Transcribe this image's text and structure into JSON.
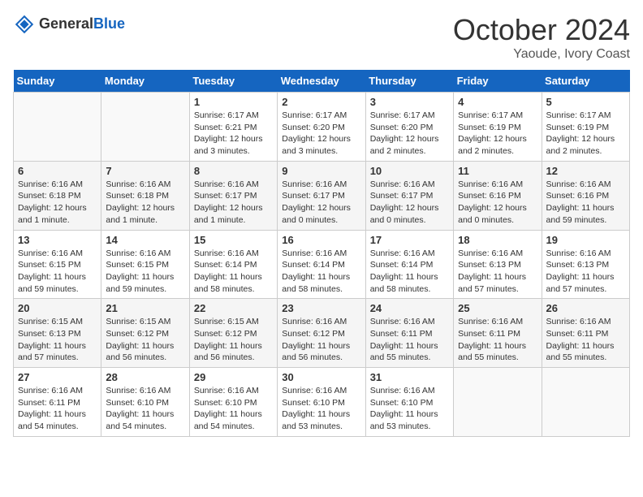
{
  "header": {
    "logo": {
      "general": "General",
      "blue": "Blue"
    },
    "month": "October 2024",
    "location": "Yaoude, Ivory Coast"
  },
  "weekdays": [
    "Sunday",
    "Monday",
    "Tuesday",
    "Wednesday",
    "Thursday",
    "Friday",
    "Saturday"
  ],
  "weeks": [
    [
      {
        "day": "",
        "info": ""
      },
      {
        "day": "",
        "info": ""
      },
      {
        "day": "1",
        "info": "Sunrise: 6:17 AM\nSunset: 6:21 PM\nDaylight: 12 hours and 3 minutes."
      },
      {
        "day": "2",
        "info": "Sunrise: 6:17 AM\nSunset: 6:20 PM\nDaylight: 12 hours and 3 minutes."
      },
      {
        "day": "3",
        "info": "Sunrise: 6:17 AM\nSunset: 6:20 PM\nDaylight: 12 hours and 2 minutes."
      },
      {
        "day": "4",
        "info": "Sunrise: 6:17 AM\nSunset: 6:19 PM\nDaylight: 12 hours and 2 minutes."
      },
      {
        "day": "5",
        "info": "Sunrise: 6:17 AM\nSunset: 6:19 PM\nDaylight: 12 hours and 2 minutes."
      }
    ],
    [
      {
        "day": "6",
        "info": "Sunrise: 6:16 AM\nSunset: 6:18 PM\nDaylight: 12 hours and 1 minute."
      },
      {
        "day": "7",
        "info": "Sunrise: 6:16 AM\nSunset: 6:18 PM\nDaylight: 12 hours and 1 minute."
      },
      {
        "day": "8",
        "info": "Sunrise: 6:16 AM\nSunset: 6:17 PM\nDaylight: 12 hours and 1 minute."
      },
      {
        "day": "9",
        "info": "Sunrise: 6:16 AM\nSunset: 6:17 PM\nDaylight: 12 hours and 0 minutes."
      },
      {
        "day": "10",
        "info": "Sunrise: 6:16 AM\nSunset: 6:17 PM\nDaylight: 12 hours and 0 minutes."
      },
      {
        "day": "11",
        "info": "Sunrise: 6:16 AM\nSunset: 6:16 PM\nDaylight: 12 hours and 0 minutes."
      },
      {
        "day": "12",
        "info": "Sunrise: 6:16 AM\nSunset: 6:16 PM\nDaylight: 11 hours and 59 minutes."
      }
    ],
    [
      {
        "day": "13",
        "info": "Sunrise: 6:16 AM\nSunset: 6:15 PM\nDaylight: 11 hours and 59 minutes."
      },
      {
        "day": "14",
        "info": "Sunrise: 6:16 AM\nSunset: 6:15 PM\nDaylight: 11 hours and 59 minutes."
      },
      {
        "day": "15",
        "info": "Sunrise: 6:16 AM\nSunset: 6:14 PM\nDaylight: 11 hours and 58 minutes."
      },
      {
        "day": "16",
        "info": "Sunrise: 6:16 AM\nSunset: 6:14 PM\nDaylight: 11 hours and 58 minutes."
      },
      {
        "day": "17",
        "info": "Sunrise: 6:16 AM\nSunset: 6:14 PM\nDaylight: 11 hours and 58 minutes."
      },
      {
        "day": "18",
        "info": "Sunrise: 6:16 AM\nSunset: 6:13 PM\nDaylight: 11 hours and 57 minutes."
      },
      {
        "day": "19",
        "info": "Sunrise: 6:16 AM\nSunset: 6:13 PM\nDaylight: 11 hours and 57 minutes."
      }
    ],
    [
      {
        "day": "20",
        "info": "Sunrise: 6:15 AM\nSunset: 6:13 PM\nDaylight: 11 hours and 57 minutes."
      },
      {
        "day": "21",
        "info": "Sunrise: 6:15 AM\nSunset: 6:12 PM\nDaylight: 11 hours and 56 minutes."
      },
      {
        "day": "22",
        "info": "Sunrise: 6:15 AM\nSunset: 6:12 PM\nDaylight: 11 hours and 56 minutes."
      },
      {
        "day": "23",
        "info": "Sunrise: 6:16 AM\nSunset: 6:12 PM\nDaylight: 11 hours and 56 minutes."
      },
      {
        "day": "24",
        "info": "Sunrise: 6:16 AM\nSunset: 6:11 PM\nDaylight: 11 hours and 55 minutes."
      },
      {
        "day": "25",
        "info": "Sunrise: 6:16 AM\nSunset: 6:11 PM\nDaylight: 11 hours and 55 minutes."
      },
      {
        "day": "26",
        "info": "Sunrise: 6:16 AM\nSunset: 6:11 PM\nDaylight: 11 hours and 55 minutes."
      }
    ],
    [
      {
        "day": "27",
        "info": "Sunrise: 6:16 AM\nSunset: 6:11 PM\nDaylight: 11 hours and 54 minutes."
      },
      {
        "day": "28",
        "info": "Sunrise: 6:16 AM\nSunset: 6:10 PM\nDaylight: 11 hours and 54 minutes."
      },
      {
        "day": "29",
        "info": "Sunrise: 6:16 AM\nSunset: 6:10 PM\nDaylight: 11 hours and 54 minutes."
      },
      {
        "day": "30",
        "info": "Sunrise: 6:16 AM\nSunset: 6:10 PM\nDaylight: 11 hours and 53 minutes."
      },
      {
        "day": "31",
        "info": "Sunrise: 6:16 AM\nSunset: 6:10 PM\nDaylight: 11 hours and 53 minutes."
      },
      {
        "day": "",
        "info": ""
      },
      {
        "day": "",
        "info": ""
      }
    ]
  ]
}
